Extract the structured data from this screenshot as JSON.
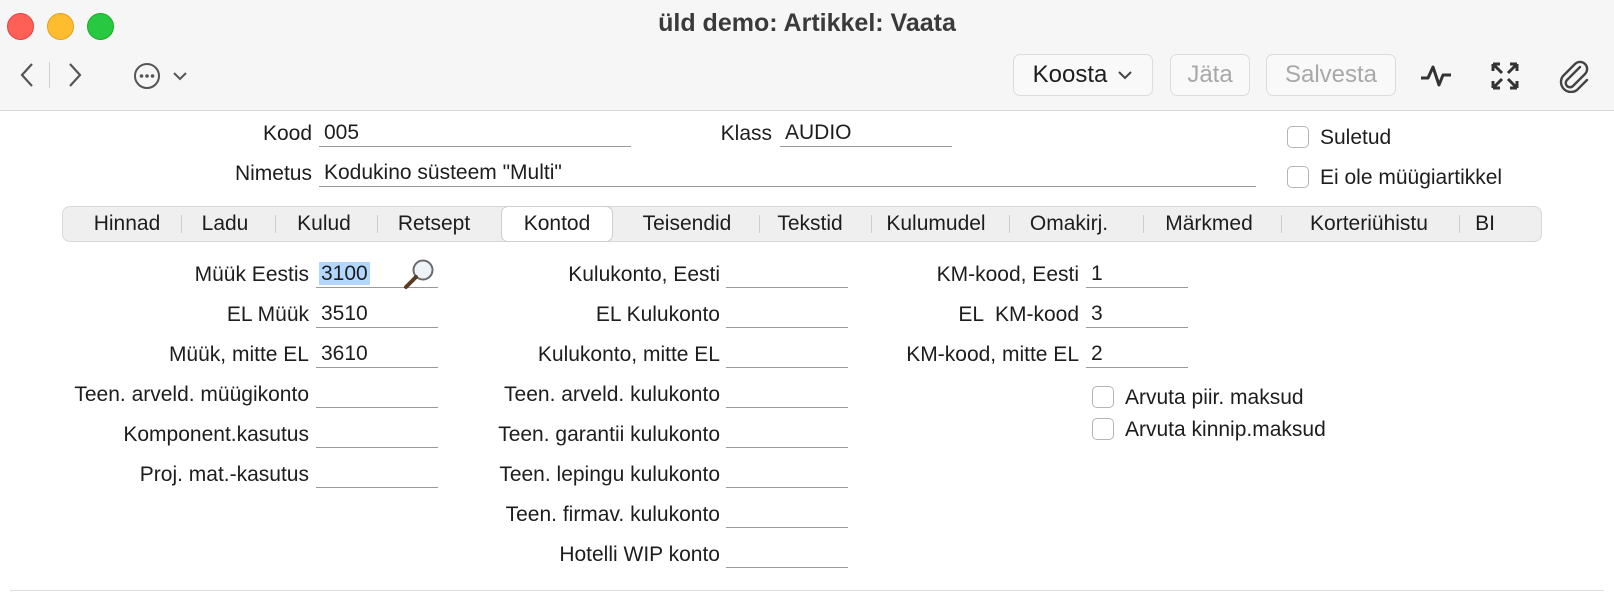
{
  "window": {
    "title": "üld demo: Artikkel: Vaata"
  },
  "toolbar": {
    "koosta_label": "Koosta",
    "jata_label": "Jäta",
    "salvesta_label": "Salvesta"
  },
  "header": {
    "kood_label": "Kood",
    "kood_value": "005",
    "klass_label": "Klass",
    "klass_value": "AUDIO",
    "nimetus_label": "Nimetus",
    "nimetus_value": "Kodukino süsteem \"Multi\"",
    "suletud_label": "Suletud",
    "ei_ole_label": "Ei ole müügiartikkel"
  },
  "tabs": [
    {
      "label": "Hinnad"
    },
    {
      "label": "Ladu"
    },
    {
      "label": "Kulud"
    },
    {
      "label": "Retsept"
    },
    {
      "label": "Kontod"
    },
    {
      "label": "Teisendid"
    },
    {
      "label": "Tekstid"
    },
    {
      "label": "Kulumudel"
    },
    {
      "label": "Omakirj."
    },
    {
      "label": "Märkmed"
    },
    {
      "label": "Korteriühistu"
    },
    {
      "label": "BI"
    }
  ],
  "active_tab": "Kontod",
  "col1": [
    {
      "label": "Müük Eestis",
      "value": "3100"
    },
    {
      "label": "EL Müük",
      "value": "3510"
    },
    {
      "label": "Müük, mitte EL",
      "value": "3610"
    },
    {
      "label": "Teen. arveld. müügikonto",
      "value": ""
    },
    {
      "label": "Komponent.kasutus",
      "value": ""
    },
    {
      "label": "Proj. mat.-kasutus",
      "value": ""
    }
  ],
  "col2": [
    {
      "label": "Kulukonto, Eesti",
      "value": ""
    },
    {
      "label": "EL Kulukonto",
      "value": ""
    },
    {
      "label": "Kulukonto, mitte EL",
      "value": ""
    },
    {
      "label": "Teen. arveld. kulukonto",
      "value": ""
    },
    {
      "label": "Teen. garantii kulukonto",
      "value": ""
    },
    {
      "label": "Teen. lepingu kulukonto",
      "value": ""
    },
    {
      "label": "Teen. firmav. kulukonto",
      "value": ""
    },
    {
      "label": "Hotelli WIP konto",
      "value": ""
    }
  ],
  "col3": [
    {
      "label": "KM-kood, Eesti",
      "value": "1"
    },
    {
      "label": "EL  KM-kood",
      "value": "3"
    },
    {
      "label": "KM-kood, mitte EL",
      "value": "2"
    }
  ],
  "checks": {
    "arvuta_piir": "Arvuta piir. maksud",
    "arvuta_kinnip": "Arvuta kinnip.maksud"
  }
}
